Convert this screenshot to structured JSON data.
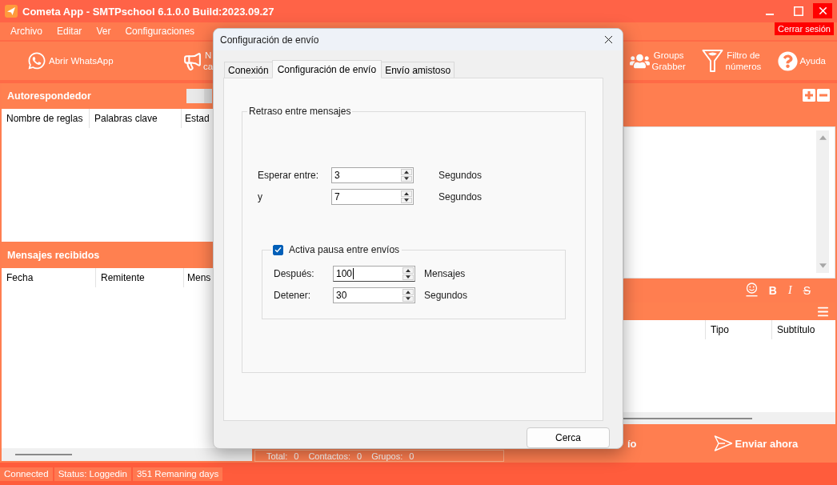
{
  "window": {
    "title": "Cometa App - SMTPschool 6.1.0.0 Build:2023.09.27"
  },
  "menu": [
    "Archivo",
    "Editar",
    "Ver",
    "Configuraciones"
  ],
  "logout_button": "Cerrar sesión",
  "toolbar": {
    "left": [
      {
        "kind": "whatsapp",
        "lines": [
          "Abrir WhatsApp"
        ]
      },
      {
        "kind": "megaphone",
        "lines": [
          "N",
          "ca"
        ]
      }
    ],
    "right": [
      {
        "kind": "groups",
        "lines": [
          "Groups",
          "Grabber"
        ]
      },
      {
        "kind": "filter",
        "lines": [
          "Filtro de",
          "números"
        ]
      },
      {
        "kind": "help",
        "lines": [
          "Ayuda"
        ]
      }
    ]
  },
  "autoresponder": {
    "title": "Autorespondedor",
    "columns": [
      "Nombre de reglas",
      "Palabras clave",
      "Estad"
    ]
  },
  "received_messages": {
    "title": "Mensajes recibidos",
    "columns": [
      "Fecha",
      "Remitente",
      "Mens"
    ]
  },
  "counts": [
    {
      "label": "Total:",
      "value": "0"
    },
    {
      "label": "Contactos:",
      "value": "0"
    },
    {
      "label": "Grupos:",
      "value": "0"
    }
  ],
  "format_buttons": [
    {
      "kind": "emoji"
    },
    {
      "kind": "bold",
      "label": "B"
    },
    {
      "kind": "italic",
      "label": "I"
    },
    {
      "kind": "strike",
      "label": "S"
    }
  ],
  "recipients_table": {
    "columns": [
      "Tipo",
      "Subtítulo"
    ]
  },
  "action_bar": {
    "partial_button": "ío",
    "send_button": "Enviar ahora"
  },
  "status_bar": [
    "Connected",
    "Status: Loggedin",
    "351 Remaning days"
  ],
  "dialog": {
    "title": "Configuración de envío",
    "tabs": [
      {
        "label": "Conexión",
        "selected": false
      },
      {
        "label": "Configuración de envío",
        "selected": true
      },
      {
        "label": "Envío amistoso",
        "selected": false
      }
    ],
    "delay_group": {
      "title": "Retraso entre mensajes",
      "rows": [
        {
          "label": "Esperar entre:",
          "value": "3",
          "unit": "Segundos",
          "focused": false
        },
        {
          "label": "y",
          "value": "7",
          "unit": "Segundos",
          "focused": false
        }
      ]
    },
    "pause_group": {
      "label": "Activa pausa entre envíos",
      "checked": true,
      "rows": [
        {
          "label": "Después:",
          "value": "100",
          "unit": "Mensajes",
          "focused": true
        },
        {
          "label": "Detener:",
          "value": "30",
          "unit": "Segundos",
          "focused": false
        }
      ]
    },
    "close_button": "Cerca"
  }
}
